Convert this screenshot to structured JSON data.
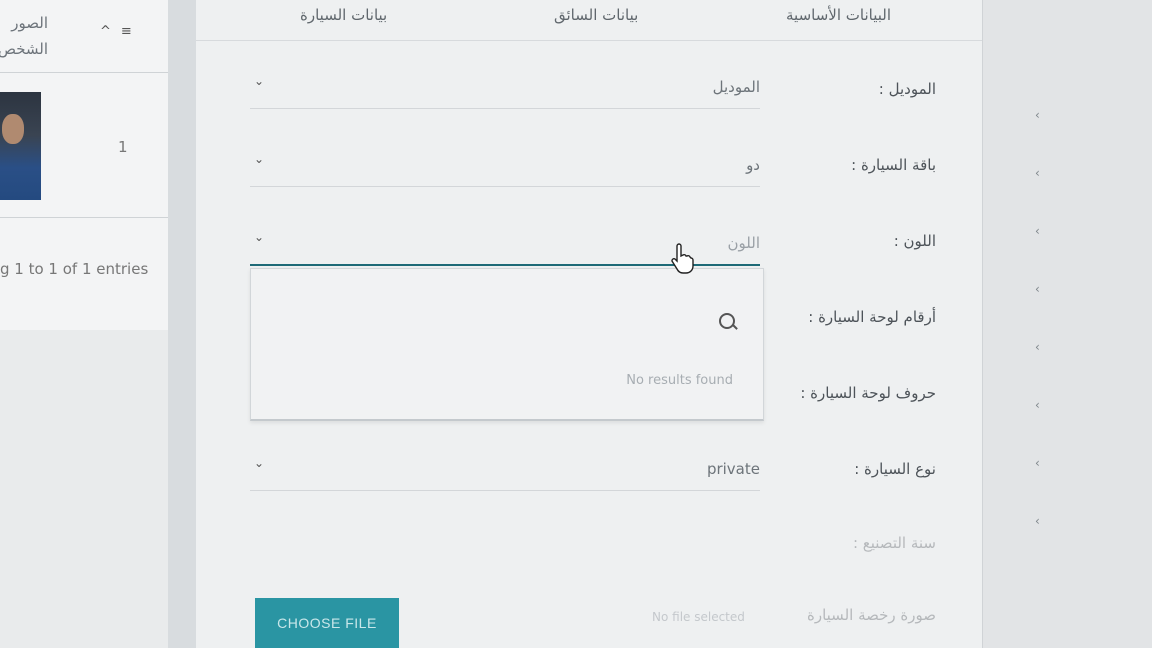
{
  "left_table": {
    "header": {
      "label_line1": "الصور",
      "label_line2": "الشخص"
    },
    "rows": [
      {
        "index": "1"
      }
    ],
    "entries_info": "g 1 to 1 of 1 entries"
  },
  "tabs": [
    {
      "label": "البيانات الأساسية"
    },
    {
      "label": "بيانات السائق"
    },
    {
      "label": "بيانات السيارة"
    }
  ],
  "form": {
    "model": {
      "label": "الموديل :",
      "value": "الموديل"
    },
    "package": {
      "label": "باقة السيارة :",
      "value": "دو"
    },
    "color": {
      "label": "اللون :",
      "placeholder": "اللون"
    },
    "plate_numbers": {
      "label": "أرقام لوحة السيارة :"
    },
    "plate_letters": {
      "label": "حروف لوحة السيارة :"
    },
    "car_type": {
      "label": "نوع السيارة :",
      "value": "private"
    },
    "manufacture_year": {
      "label": "سنة التصنيع :"
    },
    "license_image": {
      "label": "صورة رخصة السيارة"
    },
    "dropdown": {
      "no_results": "No results found"
    },
    "choose_file_label": "CHOOSE FILE",
    "no_file_label": "No file selected"
  },
  "colors": {
    "accent": "#2a95a3",
    "active_underline": "#1e6a77"
  }
}
